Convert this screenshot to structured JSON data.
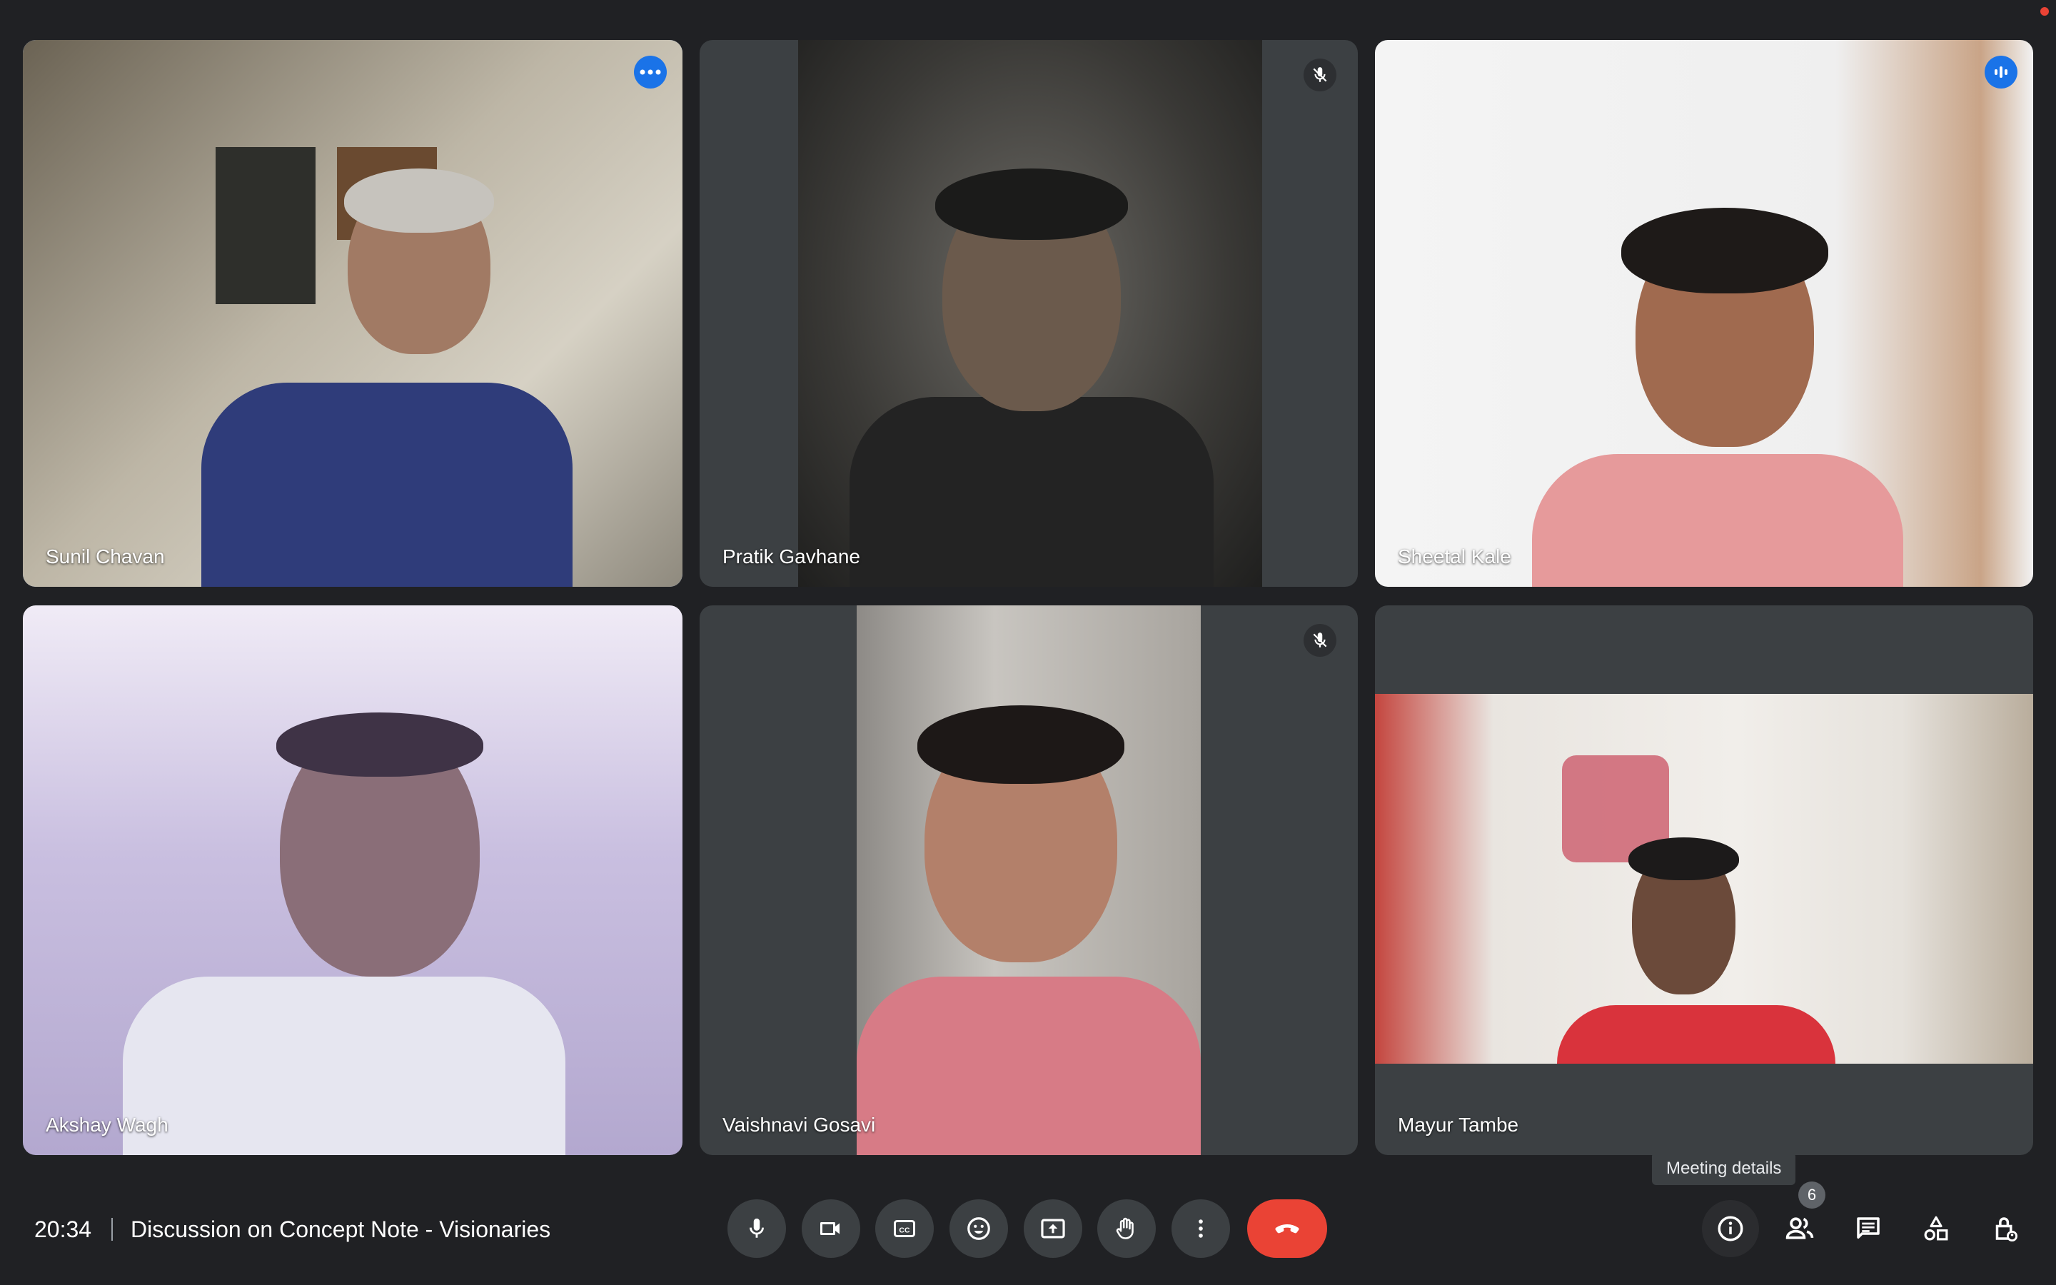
{
  "meeting": {
    "time": "20:34",
    "title": "Discussion on Concept Note - Visionaries"
  },
  "participants": [
    {
      "name": "Sunil Chavan",
      "state": "active-speaker, more-options"
    },
    {
      "name": "Pratik Gavhane",
      "state": "muted"
    },
    {
      "name": "Sheetal Kale",
      "state": "speaking"
    },
    {
      "name": "Akshay Wagh",
      "state": ""
    },
    {
      "name": "Vaishnavi Gosavi",
      "state": "muted"
    },
    {
      "name": "Mayur Tambe",
      "state": ""
    }
  ],
  "controls": {
    "icons": [
      "microphone-icon",
      "camera-icon",
      "captions-icon",
      "emoji-icon",
      "present-icon",
      "raise-hand-icon",
      "more-icon",
      "end-call-icon"
    ]
  },
  "right_controls": {
    "tooltip": "Meeting details",
    "people_count": "6",
    "icons": [
      "info-icon",
      "people-icon",
      "chat-icon",
      "activities-icon",
      "host-controls-icon"
    ]
  },
  "colors": {
    "accent": "#8ab4f8",
    "end_call": "#ea4335",
    "tile_background": "#3c4043",
    "page_background": "#202124"
  }
}
